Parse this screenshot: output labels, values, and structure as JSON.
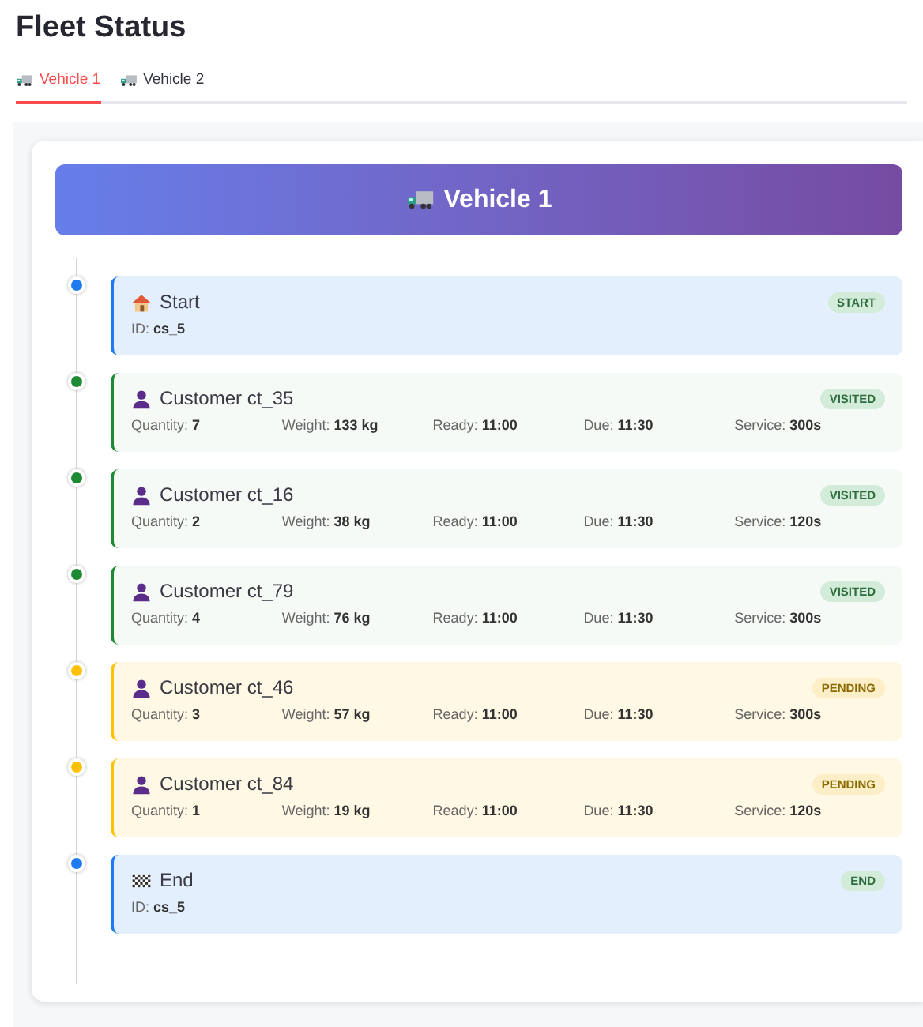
{
  "title": "Fleet Status",
  "tabs": [
    {
      "label": "Vehicle 1",
      "selected": true
    },
    {
      "label": "Vehicle 2",
      "selected": false
    }
  ],
  "vehicle": {
    "title": "Vehicle 1"
  },
  "stops": [
    {
      "kind": "start",
      "color": "#1e7bf0",
      "name": "Start",
      "badge": "START",
      "details": [
        {
          "label": "ID:",
          "value": "cs_5"
        }
      ]
    },
    {
      "kind": "customer",
      "color": "#1e8a34",
      "name": "Customer ct_35",
      "badge": "VISITED",
      "details": [
        {
          "label": "Quantity:",
          "value": "7"
        },
        {
          "label": "Weight:",
          "value": "133 kg"
        },
        {
          "label": "Ready:",
          "value": "11:00"
        },
        {
          "label": "Due:",
          "value": "11:30"
        },
        {
          "label": "Service:",
          "value": "300s"
        }
      ]
    },
    {
      "kind": "customer",
      "color": "#1e8a34",
      "name": "Customer ct_16",
      "badge": "VISITED",
      "details": [
        {
          "label": "Quantity:",
          "value": "2"
        },
        {
          "label": "Weight:",
          "value": "38 kg"
        },
        {
          "label": "Ready:",
          "value": "11:00"
        },
        {
          "label": "Due:",
          "value": "11:30"
        },
        {
          "label": "Service:",
          "value": "120s"
        }
      ]
    },
    {
      "kind": "customer",
      "color": "#1e8a34",
      "name": "Customer ct_79",
      "badge": "VISITED",
      "details": [
        {
          "label": "Quantity:",
          "value": "4"
        },
        {
          "label": "Weight:",
          "value": "76 kg"
        },
        {
          "label": "Ready:",
          "value": "11:00"
        },
        {
          "label": "Due:",
          "value": "11:30"
        },
        {
          "label": "Service:",
          "value": "300s"
        }
      ]
    },
    {
      "kind": "customer",
      "color": "#ffc107",
      "name": "Customer ct_46",
      "badge": "PENDING",
      "details": [
        {
          "label": "Quantity:",
          "value": "3"
        },
        {
          "label": "Weight:",
          "value": "57 kg"
        },
        {
          "label": "Ready:",
          "value": "11:00"
        },
        {
          "label": "Due:",
          "value": "11:30"
        },
        {
          "label": "Service:",
          "value": "300s"
        }
      ]
    },
    {
      "kind": "customer",
      "color": "#ffc107",
      "name": "Customer ct_84",
      "badge": "PENDING",
      "details": [
        {
          "label": "Quantity:",
          "value": "1"
        },
        {
          "label": "Weight:",
          "value": "19 kg"
        },
        {
          "label": "Ready:",
          "value": "11:00"
        },
        {
          "label": "Due:",
          "value": "11:30"
        },
        {
          "label": "Service:",
          "value": "120s"
        }
      ]
    },
    {
      "kind": "end",
      "color": "#1e7bf0",
      "name": "End",
      "badge": "END",
      "details": [
        {
          "label": "ID:",
          "value": "cs_5"
        }
      ]
    }
  ]
}
